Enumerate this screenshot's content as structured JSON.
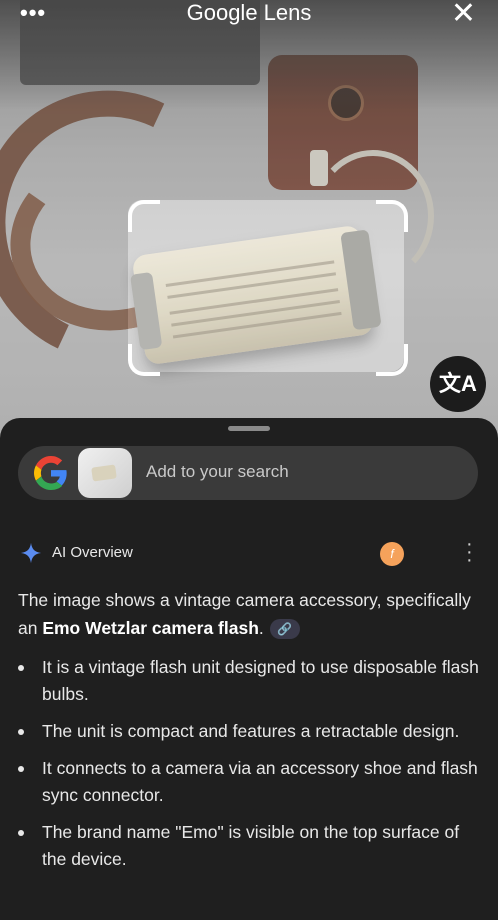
{
  "header": {
    "title": "Google Lens",
    "more_icon": "more-horiz-icon",
    "close_icon": "close-icon"
  },
  "translate": {
    "icon": "translate-icon"
  },
  "search": {
    "label": "Add to your search"
  },
  "ai_overview": {
    "title": "AI Overview",
    "avatar_letter": "f",
    "summary_prefix": "The image shows a vintage camera accessory, specifically an ",
    "summary_bold": "Emo Wetzlar camera flash",
    "summary_suffix": ".",
    "link_icon": "link-icon",
    "bullets": [
      "It is a vintage flash unit designed to use disposable flash bulbs.",
      "The unit is compact and features a retractable design.",
      "It connects to a camera via an accessory shoe and flash sync connector.",
      "The brand name \"Emo\" is visible on the top surface of the device."
    ]
  }
}
